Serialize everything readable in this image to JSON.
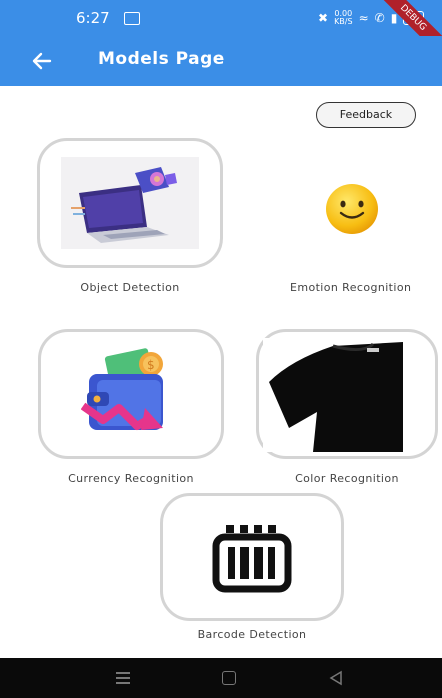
{
  "status_bar": {
    "time": "6:27",
    "data_speed_value": "0.00",
    "data_speed_unit": "KB/S",
    "battery": "10",
    "debug_banner": "DEBUG"
  },
  "app_bar": {
    "title": "Models Page",
    "color": "#3b8ee7"
  },
  "feedback_button": {
    "label": "Feedback"
  },
  "models": [
    {
      "label": "Object Detection",
      "icon": "laptop-icon"
    },
    {
      "label": "Emotion Recognition",
      "icon": "smiley-face-icon"
    },
    {
      "label": "Currency Recognition",
      "icon": "wallet-icon"
    },
    {
      "label": "Color Recognition",
      "icon": "tshirt-icon"
    },
    {
      "label": "Barcode Detection",
      "icon": "barcode-icon"
    }
  ],
  "nav_bar": {
    "icons": [
      "menu-icon",
      "home-icon",
      "back-triangle-icon"
    ]
  }
}
